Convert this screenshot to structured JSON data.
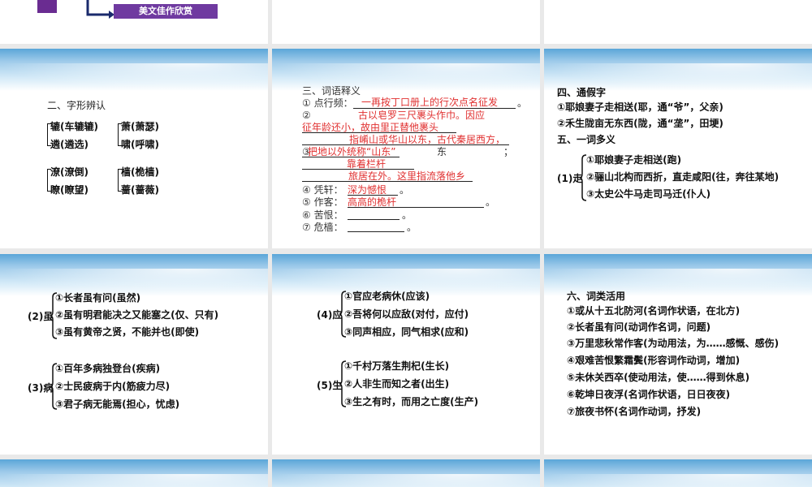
{
  "s1": {
    "button": "美文佳作欣赏"
  },
  "s4": {
    "title": "二、字形辨认",
    "g1": [
      "辘(车辘辘)",
      "遴(遴选)"
    ],
    "g2": [
      "萧(萧瑟)",
      "啸(呼啸)"
    ],
    "g3": [
      "潦(潦倒)",
      "瞭(瞭望)"
    ],
    "g4": [
      "樯(桅樯)",
      "蔷(蔷薇)"
    ]
  },
  "s5": {
    "title": "三、词语释义",
    "l1": "① 点行频：",
    "a1": "一再按丁口册上的行次点名征发",
    "l2": "②",
    "a2a": "古以皂罗三尺裹头作巾。因应",
    "a2b": "征年龄还小，故由里正替他裹头",
    "l3": "③",
    "a3a": "指崤山或华山以东，古代秦居西方，",
    "a3b": "把地以外统称“山东”",
    "a3c": "东",
    "l4": "④ 凭轩：",
    "a4": "靠着栏杆",
    "l5": "⑤ 作客：",
    "a5": "旅居在外。这里指流落他乡",
    "a6": "深为憾恨",
    "l6": "⑥ 苦恨：",
    "a7": "高高的桅杆",
    "l7": "⑦ 危樯：",
    "dot": "。",
    "semi": "；"
  },
  "s6": {
    "h1": "四、通假字",
    "i1": "①耶娘妻子走相送(耶，通“爷”，父亲)",
    "i2": "②禾生陇亩无东西(陇，通“垄”，田埂)",
    "h2": "五、一词多义",
    "head": "(1)走",
    "j1": "①耶娘妻子走相送(跑)",
    "j2": "②骊山北构而西折，直走咸阳(往，奔往某地)",
    "j3": "③太史公牛马走司马迁(仆人)"
  },
  "s7": {
    "h1": "(2)虽",
    "a": [
      "①长者虽有问(虽然)",
      "②虽有明君能决之又能塞之(仅、只有)",
      "③虽有黄帝之贤，不能并也(即使)"
    ],
    "h2": "(3)病",
    "b": [
      "①百年多病独登台(疾病)",
      "②士民疲病于内(筋疲力尽)",
      "③君子病无能焉(担心，忧虑)"
    ]
  },
  "s8": {
    "h1": "(4)应",
    "a": [
      "①官应老病休(应该)",
      "②吾将何以应敌(对付，应付)",
      "③同声相应，同气相求(应和)"
    ],
    "h2": "(5)生",
    "b": [
      "①千村万落生荆杞(生长)",
      "②人非生而知之者(出生)",
      "③生之有时，而用之亡度(生产)"
    ]
  },
  "s9": {
    "title": "六、词类活用",
    "items": [
      "①或从十五北防河(名词作状语，在北方)",
      "②长者虽有问(动词作名词，问题)",
      "③万里悲秋常作客(为动用法，为……感慨、感伤)",
      "④艰难苦恨繁霜鬓(形容词作动词，增加)",
      "⑤未休关西卒(使动用法，使……得到休息)",
      "⑥乾坤日夜浮(名词作状语，日日夜夜)",
      "⑦旅夜书怀(名词作动词，抒发)"
    ]
  }
}
